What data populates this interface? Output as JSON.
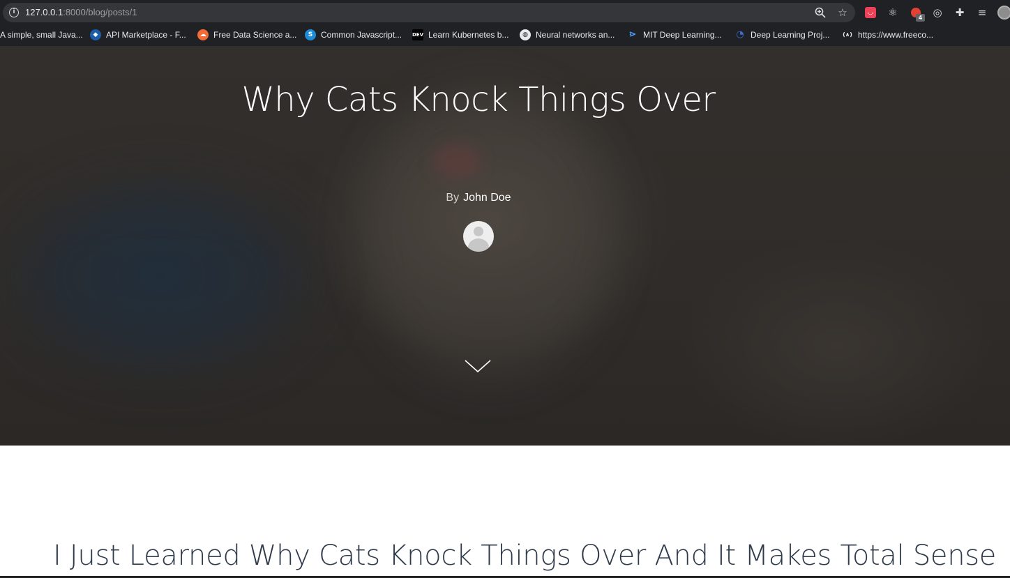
{
  "browser": {
    "url_host": "127.0.0.1",
    "url_rest": ":8000/blog/posts/1",
    "icons": {
      "info": "info-icon",
      "zoom": "zoom-icon",
      "bookmark": "star-icon",
      "extensions": [
        "pocket-icon",
        "react-devtools-icon",
        "notification-extension-icon",
        "target-icon",
        "puzzle-icon",
        "media-queue-icon",
        "profile-avatar-icon"
      ],
      "extension_badge": "4"
    },
    "bookmarks": [
      {
        "label": "A simple, small Java...",
        "icon": "",
        "color": ""
      },
      {
        "label": "API Marketplace - F...",
        "icon": "rapidapi-icon",
        "color": "#1c5ca8"
      },
      {
        "label": "Free Data Science a...",
        "icon": "cloud-icon",
        "color": "#f26b38"
      },
      {
        "label": "Common Javascript...",
        "icon": "s-icon",
        "color": "#1e8bd6"
      },
      {
        "label": "Learn Kubernetes b...",
        "icon": "dev-icon",
        "color": "#000000"
      },
      {
        "label": "Neural networks an...",
        "icon": "globe-icon",
        "color": "#ffffff"
      },
      {
        "label": "MIT Deep Learning...",
        "icon": "share-icon",
        "color": "#4aa3ff"
      },
      {
        "label": "Deep Learning Proj...",
        "icon": "spiral-icon",
        "color": "#3b6fd1"
      },
      {
        "label": "https://www.freeco...",
        "icon": "freecodecamp-icon",
        "color": "#ffffff"
      }
    ]
  },
  "hero": {
    "title": "Why Cats Knock Things Over",
    "by_label": "By",
    "author": "John Doe",
    "scroll_icon": "chevron-down-icon"
  },
  "article": {
    "heading": "I Just Learned Why Cats Knock Things Over And It Makes Total Sense"
  }
}
